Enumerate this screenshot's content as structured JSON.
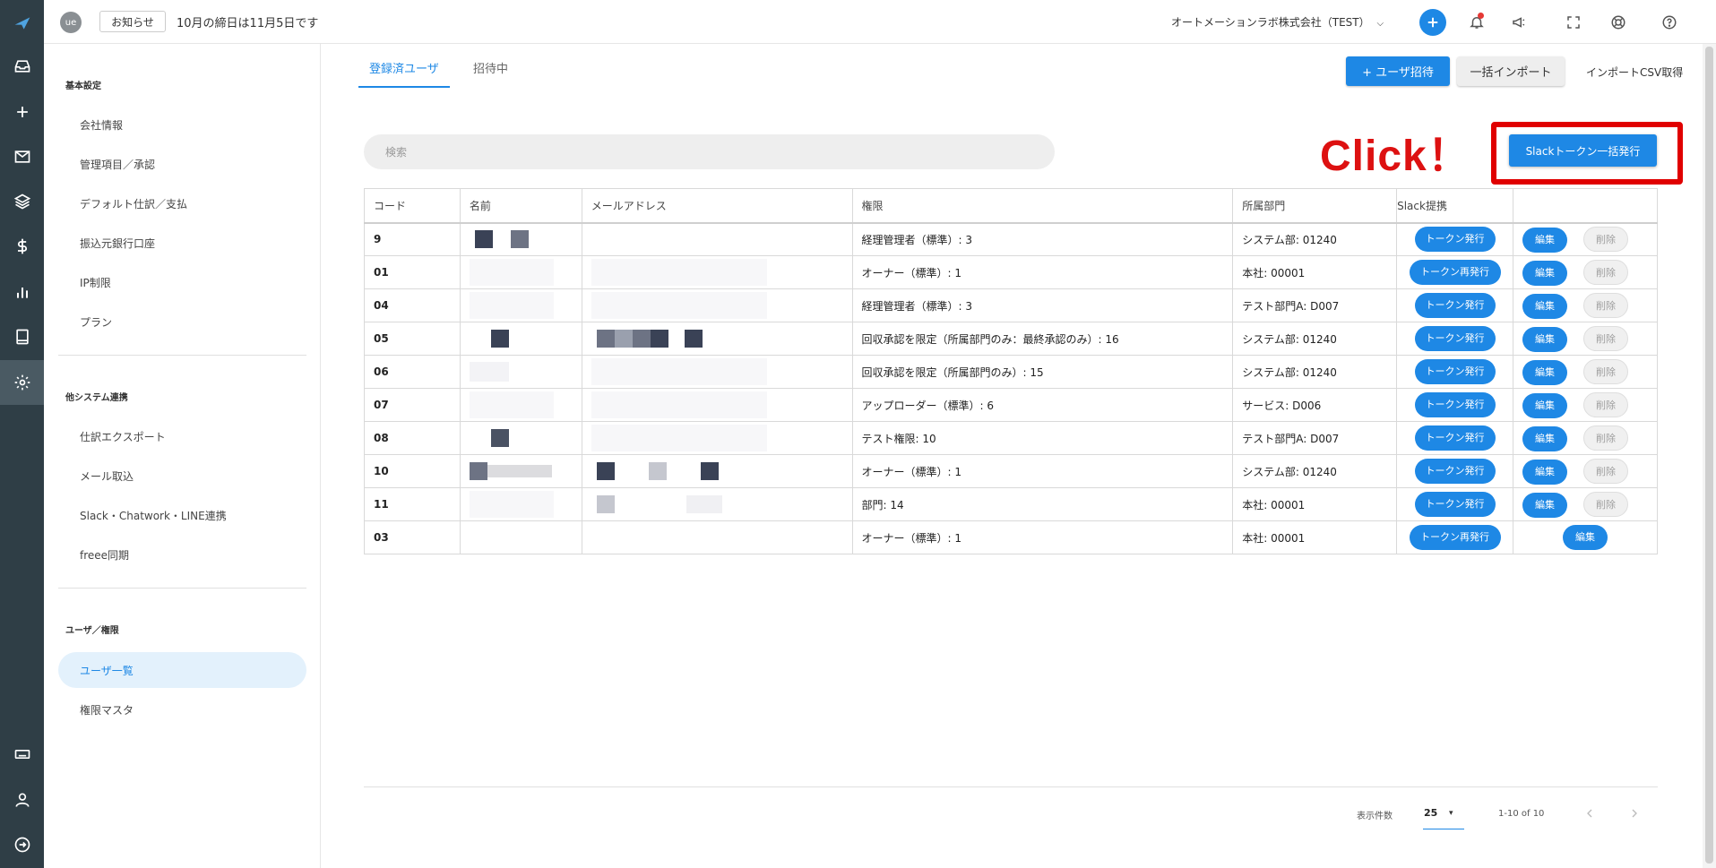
{
  "topbar": {
    "avatar_initials": "ue",
    "notice_button": "お知らせ",
    "notice_message": "10月の締日は11月5日です",
    "company": "オートメーションラボ株式会社（TEST）",
    "company_caret": "⌵"
  },
  "sidebar": {
    "sections": [
      {
        "title": "基本設定",
        "items": [
          "会社情報",
          "管理項目／承認",
          "デフォルト仕訳／支払",
          "振込元銀行口座",
          "IP制限",
          "プラン"
        ]
      },
      {
        "title": "他システム連携",
        "items": [
          "仕訳エクスポート",
          "メール取込",
          "Slack・Chatwork・LINE連携",
          "freee同期"
        ]
      },
      {
        "title": "ユーザ／権限",
        "items": [
          "ユーザ一覧",
          "権限マスタ"
        ]
      }
    ]
  },
  "tabs": {
    "registered": "登録済ユーザ",
    "invited": "招待中"
  },
  "actions": {
    "invite": "+ ユーザ招待",
    "bulk_import": "一括インポート",
    "import_csv": "インポートCSV取得",
    "slack_bulk": "Slackトークン一括発行"
  },
  "search": {
    "placeholder": "検索"
  },
  "annotation": {
    "click": "Click！"
  },
  "table": {
    "headers": [
      "コード",
      "名前",
      "メールアドレス",
      "権限",
      "所属部門",
      "Slack提携",
      ""
    ],
    "token_issue": "トークン発行",
    "token_reissue": "トークン再発行",
    "edit": "編集",
    "delete": "削除",
    "rows": [
      {
        "code": "9",
        "role": "経理管理者（標準）: 3",
        "dept": "システム部: 01240",
        "slack": "トークン発行"
      },
      {
        "code": "01",
        "role": "オーナー（標準）: 1",
        "dept": "本社: 00001",
        "slack": "トークン再発行"
      },
      {
        "code": "04",
        "role": "経理管理者（標準）: 3",
        "dept": "テスト部門A: D007",
        "slack": "トークン発行"
      },
      {
        "code": "05",
        "role": "回収承認を限定（所属部門のみ：最終承認のみ）: 16",
        "dept": "システム部: 01240",
        "slack": "トークン発行"
      },
      {
        "code": "06",
        "role": "回収承認を限定（所属部門のみ）: 15",
        "dept": "システム部: 01240",
        "slack": "トークン発行"
      },
      {
        "code": "07",
        "role": "アップローダー（標準）: 6",
        "dept": "サービス: D006",
        "slack": "トークン発行"
      },
      {
        "code": "08",
        "role": "テスト権限: 10",
        "dept": "テスト部門A: D007",
        "slack": "トークン発行"
      },
      {
        "code": "10",
        "role": "オーナー（標準）: 1",
        "dept": "システム部: 01240",
        "slack": "トークン発行"
      },
      {
        "code": "11",
        "role": "部門: 14",
        "dept": "本社: 00001",
        "slack": "トークン発行"
      },
      {
        "code": "03",
        "role": "オーナー（標準）: 1",
        "dept": "本社: 00001",
        "slack": "トークン再発行"
      }
    ]
  },
  "pagination": {
    "rows_label": "表示件数",
    "rows_value": "25",
    "rows_caret": "▾",
    "range": "1-10 of 10"
  },
  "colors": {
    "accent": "#1e88e5",
    "rail": "#2f3e46",
    "annotation": "#dd1111"
  }
}
